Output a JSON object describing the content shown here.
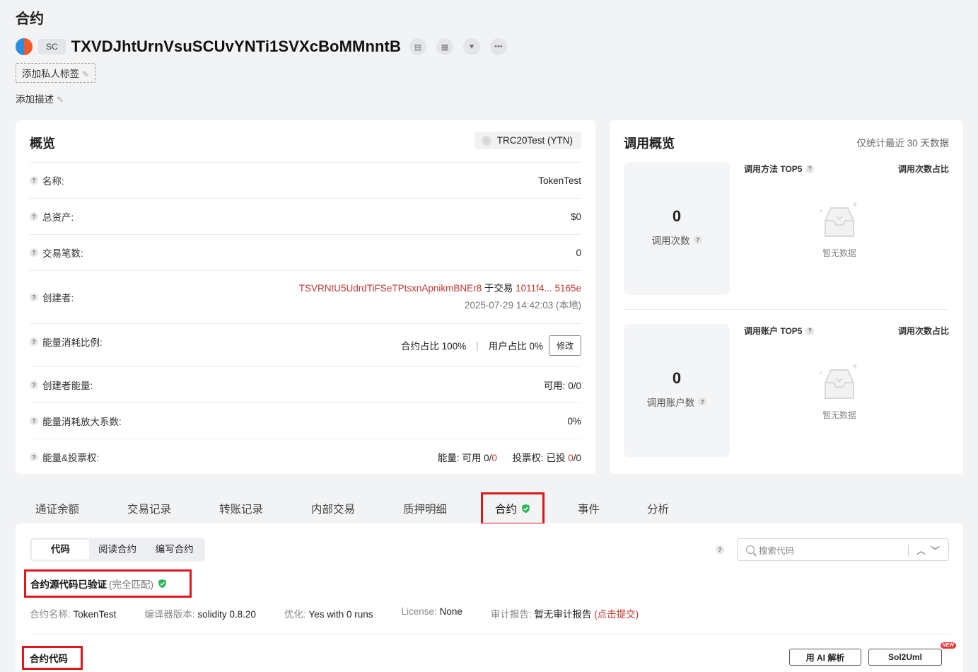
{
  "page": {
    "title": "合约"
  },
  "header": {
    "badge": "SC",
    "address": "TXVDJhtUrnVsuSCUvYNTi1SVXcBoMMnntB",
    "add_tag": "添加私人标签",
    "add_desc": "添加描述"
  },
  "overview": {
    "title": "概览",
    "token": "TRC20Test (YTN)",
    "name_label": "名称:",
    "name_value": "TokenTest",
    "assets_label": "总资产:",
    "assets_value": "$0",
    "txcount_label": "交易笔数:",
    "txcount_value": "0",
    "creator_label": "创建者:",
    "creator_address": "TSVRNtU5UdrdTiFSeTPtsxnApnikmBNEr8",
    "creator_in_tx": "于交易",
    "creator_tx": "1011f4... 5165e",
    "creator_time": "2025-07-29 14:42:03 (本地)",
    "energy_ratio_label": "能量消耗比例:",
    "energy_ratio_contract": "合约占比 100%",
    "energy_ratio_user": "用户占比 0%",
    "edit_label": "修改",
    "creator_energy_label": "创建者能量:",
    "creator_energy_key": "可用:",
    "creator_energy_value": "0/0",
    "energy_factor_label": "能量消耗放大系数:",
    "energy_factor_value": "0%",
    "energy_vote_label": "能量&投票权:",
    "energy_key": "能量:",
    "energy_avail": "可用 0/",
    "energy_avail_red": "0",
    "vote_key": "投票权:",
    "vote_val": "已投 ",
    "vote_red": "0",
    "vote_tail": "/0"
  },
  "calls": {
    "title": "调用概览",
    "note": "仅统计最近 30 天数据",
    "calls_count": "0",
    "calls_count_label": "调用次数",
    "method_top": "调用方法 TOP5",
    "ratio_label_1": "调用次数占比",
    "empty_1": "暂无数据",
    "accounts_count": "0",
    "accounts_count_label": "调用账户数",
    "account_top": "调用账户 TOP5",
    "ratio_label_2": "调用次数占比",
    "empty_2": "暂无数据"
  },
  "tabs": [
    "通证余额",
    "交易记录",
    "转账记录",
    "内部交易",
    "质押明细",
    "合约",
    "事件",
    "分析"
  ],
  "contract": {
    "seg_code": "代码",
    "seg_read": "阅读合约",
    "seg_write": "编写合约",
    "search_placeholder": "搜索代码",
    "verified": "合约源代码已验证",
    "verified_match": "(完全匹配)",
    "name_key": "合约名称:",
    "name_val": "TokenTest",
    "compiler_key": "编译器版本:",
    "compiler_val": "solidity 0.8.20",
    "opt_key": "优化:",
    "opt_val": "Yes with 0 runs",
    "license_key": "License:",
    "license_val": "None",
    "audit_key": "审计报告:",
    "audit_val": "暂无审计报告",
    "audit_link": "(点击提交)",
    "code_title": "合约代码",
    "ai_btn": "用 AI 解析",
    "sol_btn": "Sol2Uml",
    "new_badge": "NEW"
  },
  "colors": {
    "accent_red": "#c23631",
    "highlight": "#e0161b",
    "verified_green": "#2fb45a"
  }
}
